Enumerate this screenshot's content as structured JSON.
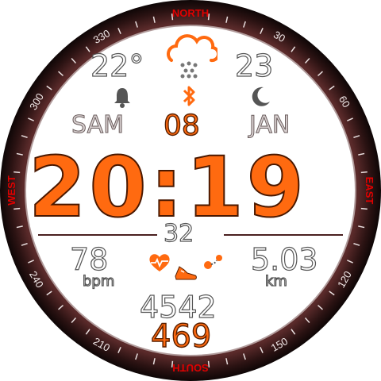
{
  "bezel": {
    "north": "NORTH",
    "south": "SOUTH",
    "east": "EAST",
    "west": "WEST",
    "degrees": [
      "30",
      "60",
      "120",
      "150",
      "210",
      "240",
      "300",
      "330"
    ],
    "accent_color": "#e00000",
    "ring_color": "#2a1414"
  },
  "weather": {
    "temperature": "22°",
    "secondary_value": "23",
    "icon": "cloud-snow-icon"
  },
  "status": {
    "alarm_icon": "bell-icon",
    "bluetooth_icon": "bluetooth-icon",
    "night_icon": "moon-icon"
  },
  "date": {
    "weekday": "SAM",
    "day": "08",
    "month": "JAN"
  },
  "time": "20:19",
  "seconds": "32",
  "health": {
    "heart_rate": "78",
    "heart_unit": "bpm",
    "distance": "5.03",
    "distance_unit": "km",
    "steps": "4542",
    "calories": "469"
  },
  "colors": {
    "primary": "#ff6a10",
    "text_outline": "#555555"
  }
}
